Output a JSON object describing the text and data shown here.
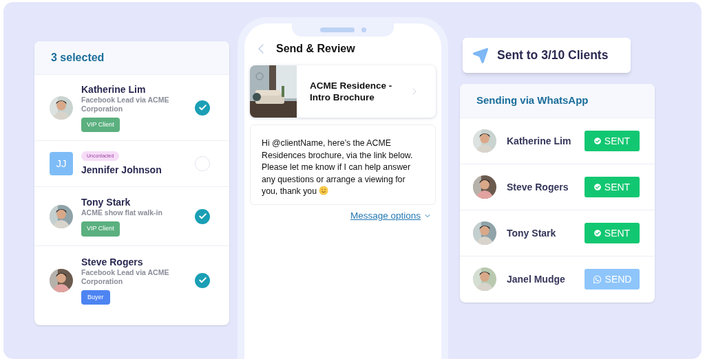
{
  "selection_panel": {
    "title": "3 selected",
    "clients": [
      {
        "name": "Katherine Lim",
        "subtitle": "Facebook Lead via ACME Corporation",
        "tag": {
          "label": "VIP Client",
          "kind": "vip"
        },
        "selected": true
      },
      {
        "name": "Jennifer Johnson",
        "tag": {
          "label": "Uncontacted",
          "kind": "uncontacted"
        },
        "avatar": {
          "kind": "initials",
          "initials": "JJ"
        },
        "selected": false
      },
      {
        "name": "Tony Stark",
        "subtitle": "ACME show flat walk-in",
        "tag": {
          "label": "VIP Client",
          "kind": "vip"
        },
        "selected": true
      },
      {
        "name": "Steve Rogers",
        "subtitle": "Facebook Lead via ACME Corporation",
        "tag": {
          "label": "Buyer",
          "kind": "buyer"
        },
        "selected": true
      }
    ]
  },
  "phone": {
    "title": "Send & Review",
    "brochure": {
      "title": "ACME Residence - Intro Brochure"
    },
    "message": "Hi @clientName, here’s the ACME Residences brochure, via the link below. Please let me know if I can help answer any questions or arrange a viewing for you, thank you",
    "message_options": "Message options"
  },
  "sent_summary": "Sent to 3/10 Clients",
  "sending_panel": {
    "title": "Sending via WhatsApp",
    "recipients": [
      {
        "name": "Katherine Lim",
        "kind": "sent",
        "button": "SENT"
      },
      {
        "name": "Steve Rogers",
        "kind": "sent",
        "button": "SENT"
      },
      {
        "name": "Tony Stark",
        "kind": "sent",
        "button": "SENT"
      },
      {
        "name": "Janel Mudge",
        "kind": "pending",
        "button": "SEND"
      }
    ]
  }
}
